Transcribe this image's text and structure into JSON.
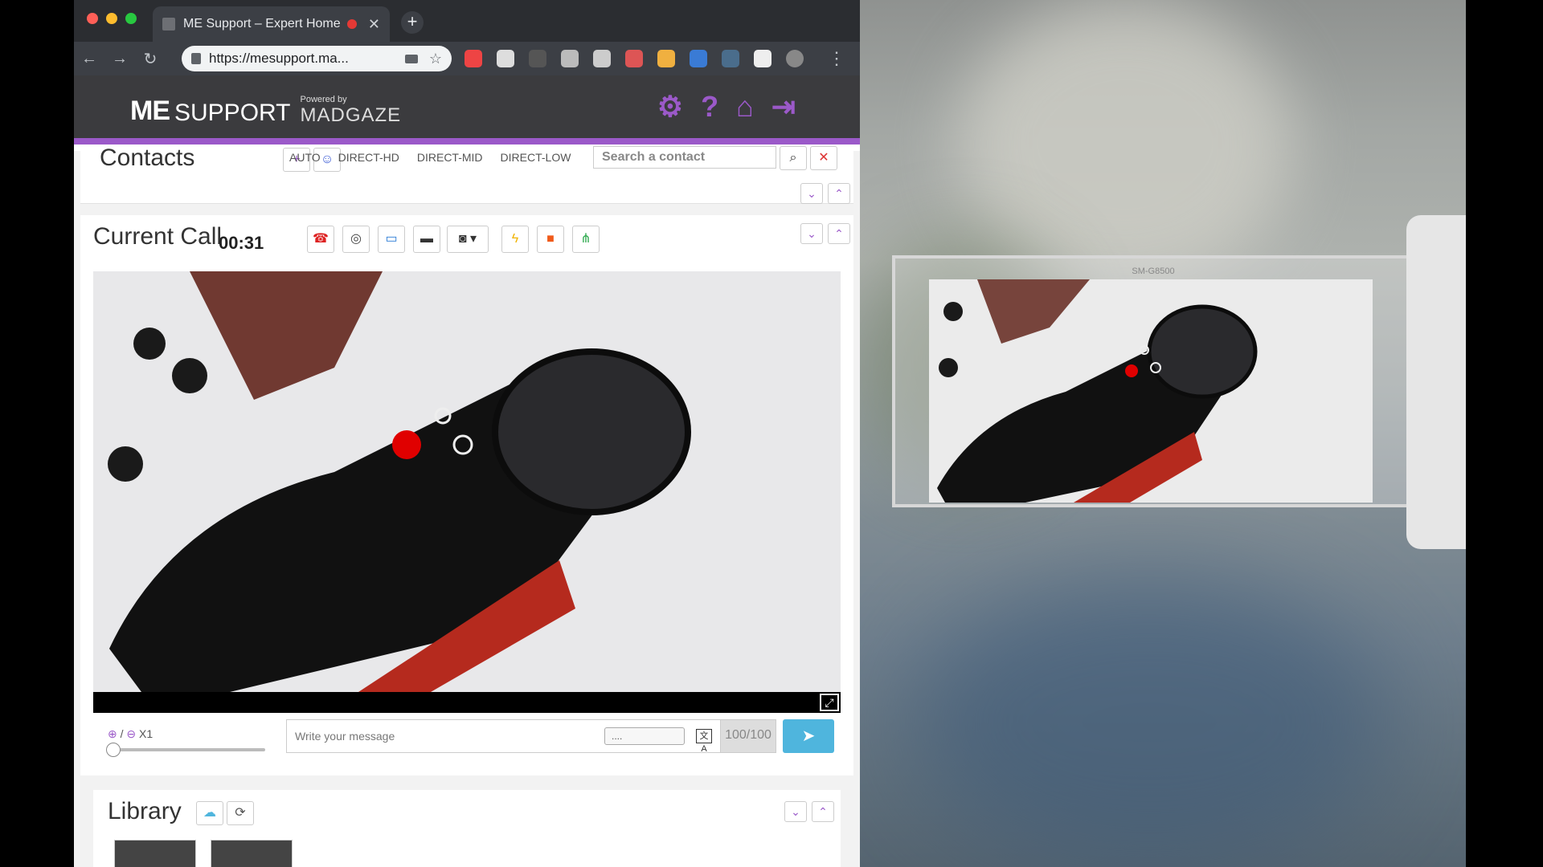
{
  "browser": {
    "tab_title": "ME Support – Expert Home",
    "url": "https://mesupport.ma..."
  },
  "app": {
    "logo_me": "ME",
    "logo_support": "SUPPORT",
    "powered_by": "Powered by",
    "brand": "MADGAZE",
    "accent": "#9b59c9"
  },
  "contacts": {
    "title": "Contacts",
    "modes": [
      "AUTO",
      "DIRECT-HD",
      "DIRECT-MID",
      "DIRECT-LOW"
    ],
    "search_placeholder": "Search a contact"
  },
  "call": {
    "title": "Current Call",
    "timer": "00:31"
  },
  "chat": {
    "zoom_label": "X1",
    "message_placeholder": "Write your message",
    "select_value": "....",
    "counter": "100/100"
  },
  "library": {
    "title": "Library"
  },
  "device": {
    "label": "SM-G8500"
  }
}
